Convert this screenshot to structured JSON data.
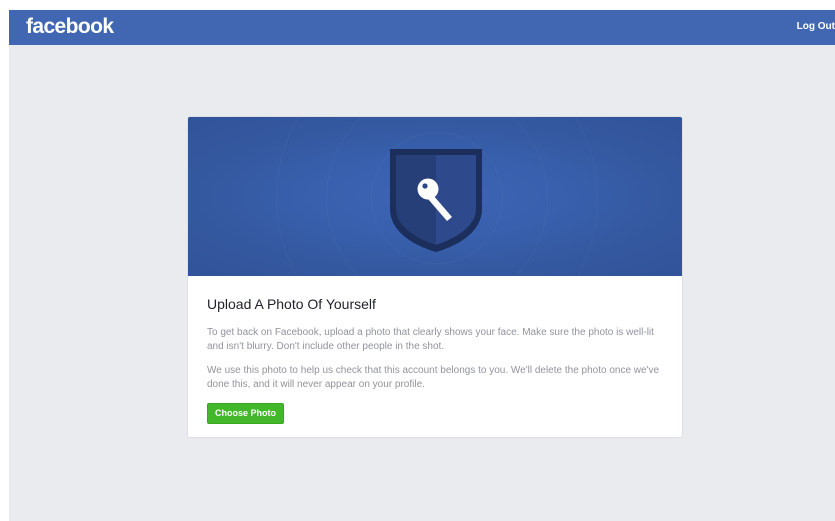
{
  "header": {
    "logo_text": "facebook",
    "logout_label": "Log Out"
  },
  "card": {
    "icon": "shield-key-icon",
    "title": "Upload A Photo Of Yourself",
    "paragraph_1": "To get back on Facebook, upload a photo that clearly shows your face. Make sure the photo is well-lit and isn't blurry. Don't include other people in the shot.",
    "paragraph_2": "We use this photo to help us check that this account belongs to you. We'll delete the photo once we've done this, and it will never appear on your profile.",
    "button_label": "Choose Photo"
  },
  "colors": {
    "brand_blue": "#4267b2",
    "banner_blue": "#3b5ca8",
    "button_green": "#42b72a",
    "page_background": "#e9ebee"
  }
}
